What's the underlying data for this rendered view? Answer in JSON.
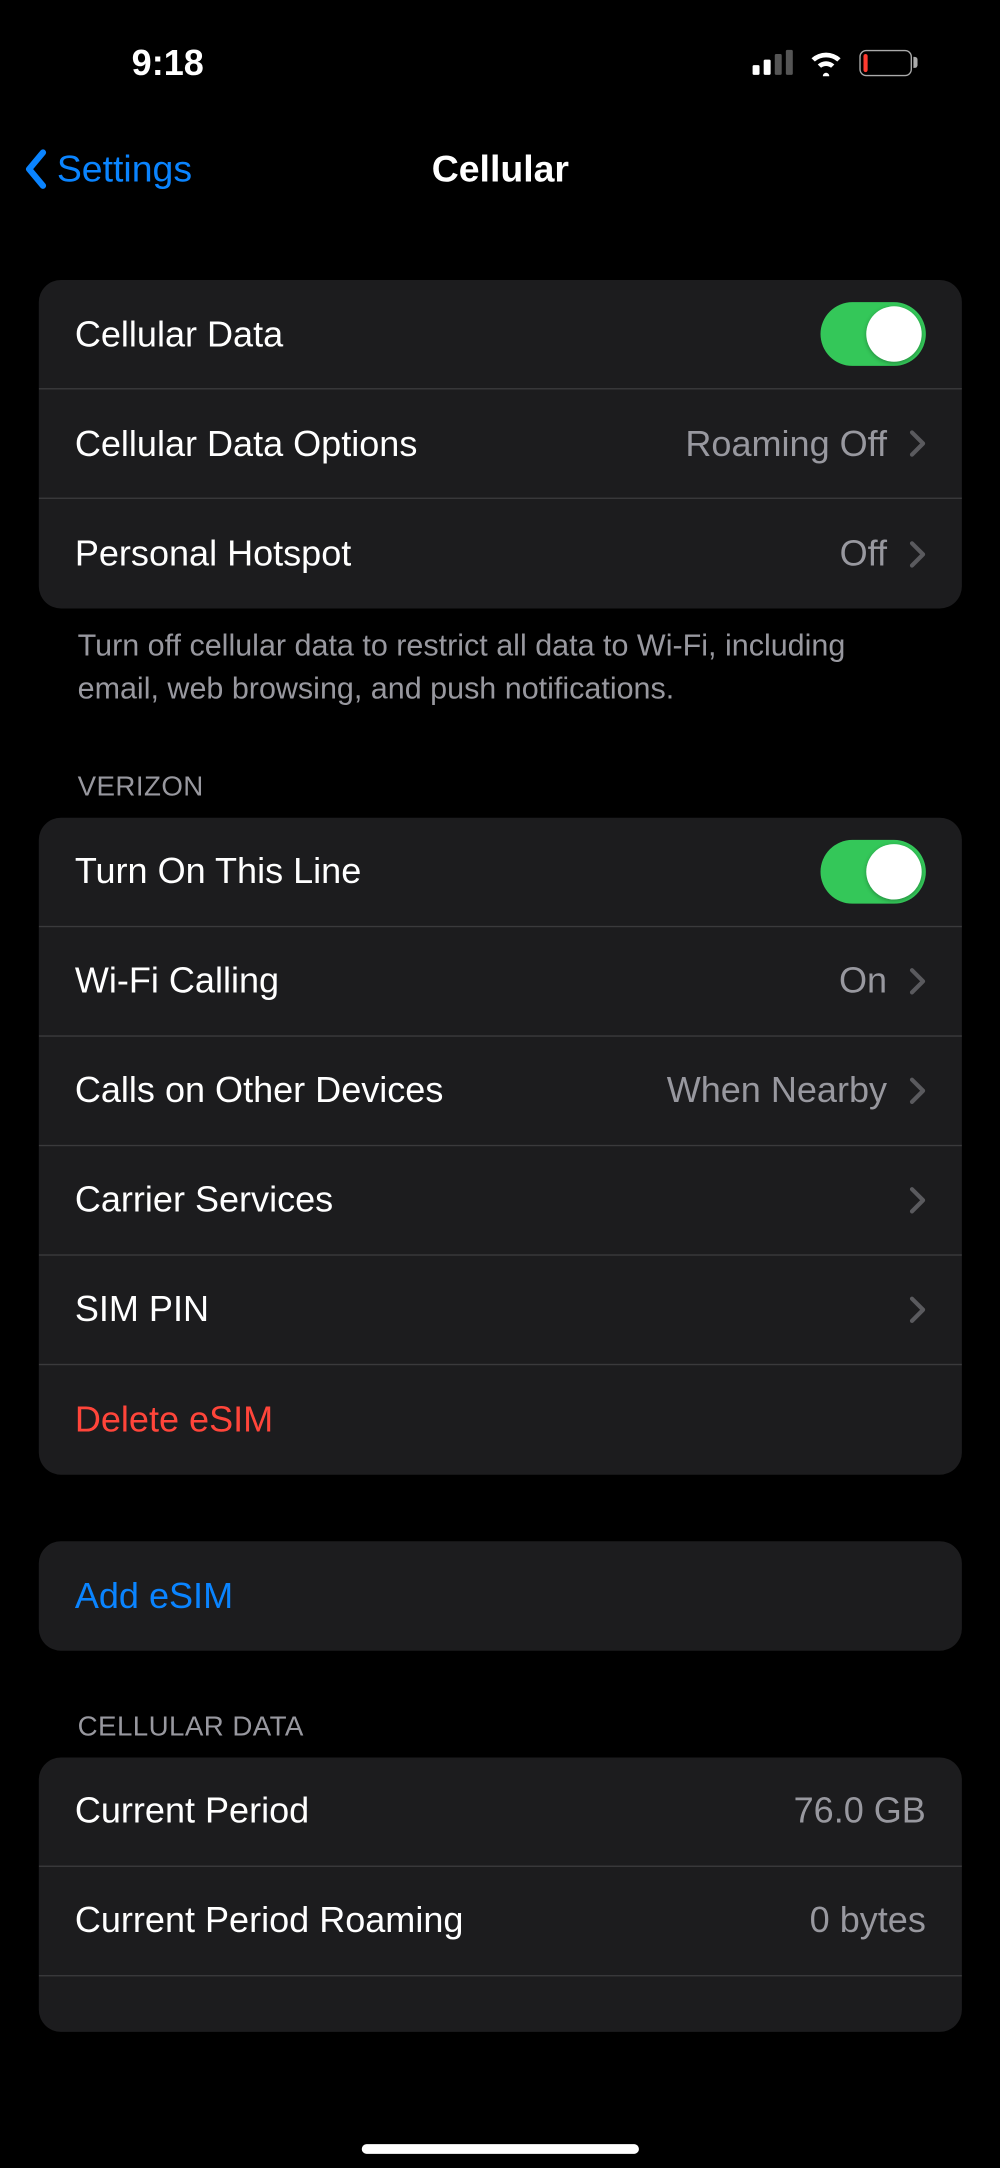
{
  "status": {
    "time": "9:18"
  },
  "nav": {
    "back": "Settings",
    "title": "Cellular"
  },
  "group1": {
    "rows": [
      {
        "label": "Cellular Data"
      },
      {
        "label": "Cellular Data Options",
        "value": "Roaming Off"
      },
      {
        "label": "Personal Hotspot",
        "value": "Off"
      }
    ],
    "footer": "Turn off cellular data to restrict all data to Wi-Fi, including email, web browsing, and push notifications."
  },
  "group2": {
    "header": "VERIZON",
    "rows": [
      {
        "label": "Turn On This Line"
      },
      {
        "label": "Wi-Fi Calling",
        "value": "On"
      },
      {
        "label": "Calls on Other Devices",
        "value": "When Nearby"
      },
      {
        "label": "Carrier Services"
      },
      {
        "label": "SIM PIN"
      },
      {
        "label": "Delete eSIM"
      }
    ]
  },
  "group3": {
    "rows": [
      {
        "label": "Add eSIM"
      }
    ]
  },
  "group4": {
    "header": "CELLULAR DATA",
    "rows": [
      {
        "label": "Current Period",
        "value": "76.0 GB"
      },
      {
        "label": "Current Period Roaming",
        "value": "0 bytes"
      }
    ]
  }
}
